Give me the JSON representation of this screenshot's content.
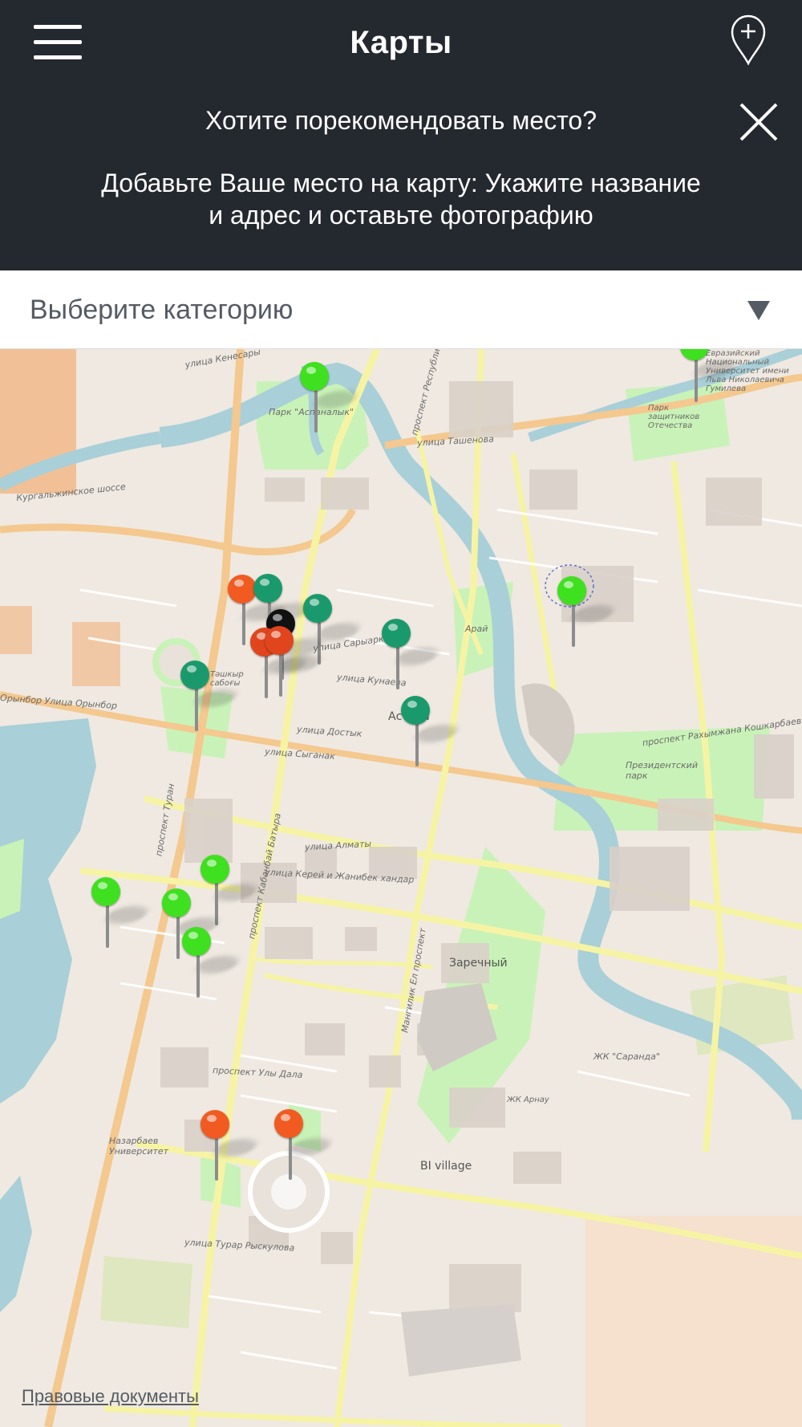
{
  "header": {
    "title": "Карты",
    "menu_icon": "hamburger-menu-icon",
    "add_place_icon": "add-location-pin-icon"
  },
  "promo": {
    "question": "Хотите порекомендовать место?",
    "text": "Добавьте Ваше место на карту: Укажите название и адрес и оставьте фотографию",
    "close_icon": "close-icon"
  },
  "category_select": {
    "placeholder": "Выберите категорию",
    "arrow_icon": "triangle-down-icon"
  },
  "map": {
    "labels": {
      "park_aspanalyk": "Парк \"Аспаналык\"",
      "park_defenders": "Парк защитников Отечества",
      "university": "Евразийский Национальный Университет имени Льва Николаевича Гумилева",
      "arai": "Арай",
      "astana": "Астана",
      "tashkyt": "Тәшкыр сабоғы",
      "presidential_park": "Президентский парк",
      "zarechny": "Заречный",
      "saranda": "ЖК \"Саранда\"",
      "arnau": "ЖК Арнау",
      "nazarbayev_univ": "Назарбаев Университет",
      "bi_village": "BI village",
      "st_kenesary": "улица Кенесары",
      "st_tasheneva": "улица Ташенова",
      "st_kurgalzhin": "Кургальжинское шоссе",
      "st_orynbor": "Орынбор Улица Орынбор",
      "st_saryarka": "улица Сарыарка",
      "st_kunaeva": "улица Кунаева",
      "st_dostyk": "улица Достык",
      "st_syganak": "улица Сыганак",
      "st_almaty": "улица Алматы",
      "st_kerei": "улица Керей и Жанибек хандар",
      "st_uly_dala": "проспект Улы Дала",
      "st_turan": "проспект Туран",
      "st_kabanbai": "проспект Кабанбай Батыра",
      "st_mangilik": "Мангилик Ел проспект",
      "st_respubliki": "проспект Республики",
      "st_rakhymzhan": "проспект Рахымжана Кошкарбаева",
      "st_turar": "улица Турар Рыскулова"
    },
    "pins": [
      {
        "color": "#3fe01f",
        "name": "pin-green"
      },
      {
        "color": "#3fe01f",
        "name": "pin-green"
      },
      {
        "color": "#f15b22",
        "name": "pin-orange"
      },
      {
        "color": "#1a9a6c",
        "name": "pin-teal"
      },
      {
        "color": "#1a9a6c",
        "name": "pin-teal"
      },
      {
        "color": "#111111",
        "name": "pin-black"
      },
      {
        "color": "#e0451d",
        "name": "pin-red"
      },
      {
        "color": "#e0451d",
        "name": "pin-red"
      },
      {
        "color": "#1a9a6c",
        "name": "pin-teal"
      },
      {
        "color": "#1a9a6c",
        "name": "pin-teal"
      },
      {
        "color": "#1a9a6c",
        "name": "pin-teal"
      },
      {
        "color": "#3fe01f",
        "name": "pin-green"
      },
      {
        "color": "#3fe01f",
        "name": "pin-green"
      },
      {
        "color": "#3fe01f",
        "name": "pin-green"
      },
      {
        "color": "#3fe01f",
        "name": "pin-green"
      },
      {
        "color": "#3fe01f",
        "name": "pin-green"
      },
      {
        "color": "#f15b22",
        "name": "pin-orange"
      },
      {
        "color": "#f15b22",
        "name": "pin-orange"
      }
    ]
  },
  "footer": {
    "legal_link": "Правовые документы"
  },
  "colors": {
    "header_bg": "#24282f",
    "map_bg": "#efe9e1",
    "park": "#c9f2b8",
    "water": "#a9cfd8",
    "road_yellow": "#f6f4a4",
    "road_orange": "#f4c88e"
  }
}
